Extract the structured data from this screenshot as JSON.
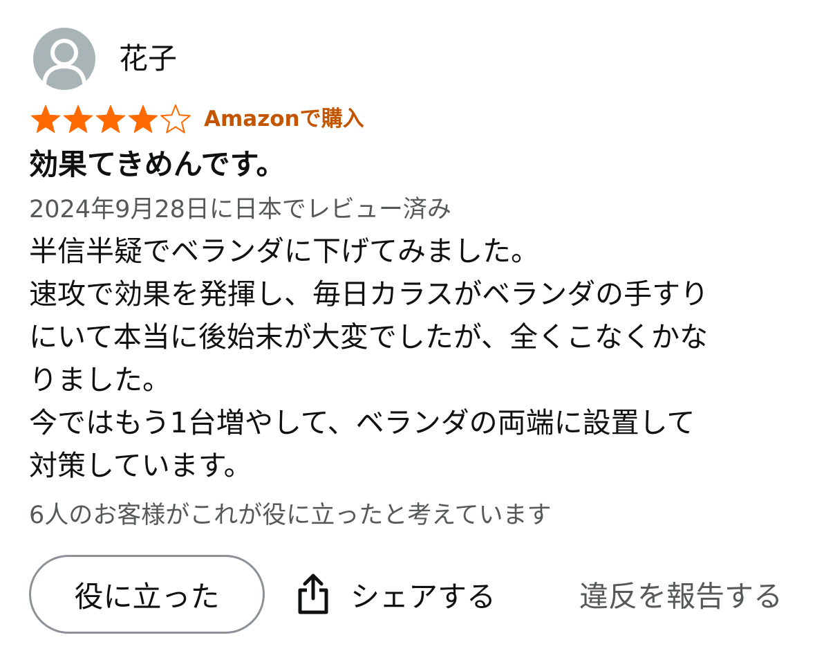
{
  "reviewer": {
    "name": "花子",
    "avatar_icon": "default-user-avatar"
  },
  "rating": {
    "value": 4,
    "max": 5,
    "star_color": "#ff6a00",
    "empty_star_color": "#ff6a00"
  },
  "verified_label": "Amazonで購入",
  "verified_color": "#c45500",
  "title": "効果てきめんです。",
  "date_line": "2024年9月28日に日本でレビュー済み",
  "body_lines": [
    "半信半疑でベランダに下げてみました。",
    "速攻で効果を発揮し、毎日カラスがベランダの手すり",
    "にいて本当に後始末が大変でしたが、全くこなくかな",
    "りました。",
    "今ではもう1台増やして、ベランダの両端に設置して",
    "対策しています。"
  ],
  "helpful_count_text": "6人のお客様がこれが役に立ったと考えています",
  "actions": {
    "helpful_label": "役に立った",
    "share_label": "シェアする",
    "share_icon": "share-icon",
    "report_label": "違反を報告する"
  }
}
